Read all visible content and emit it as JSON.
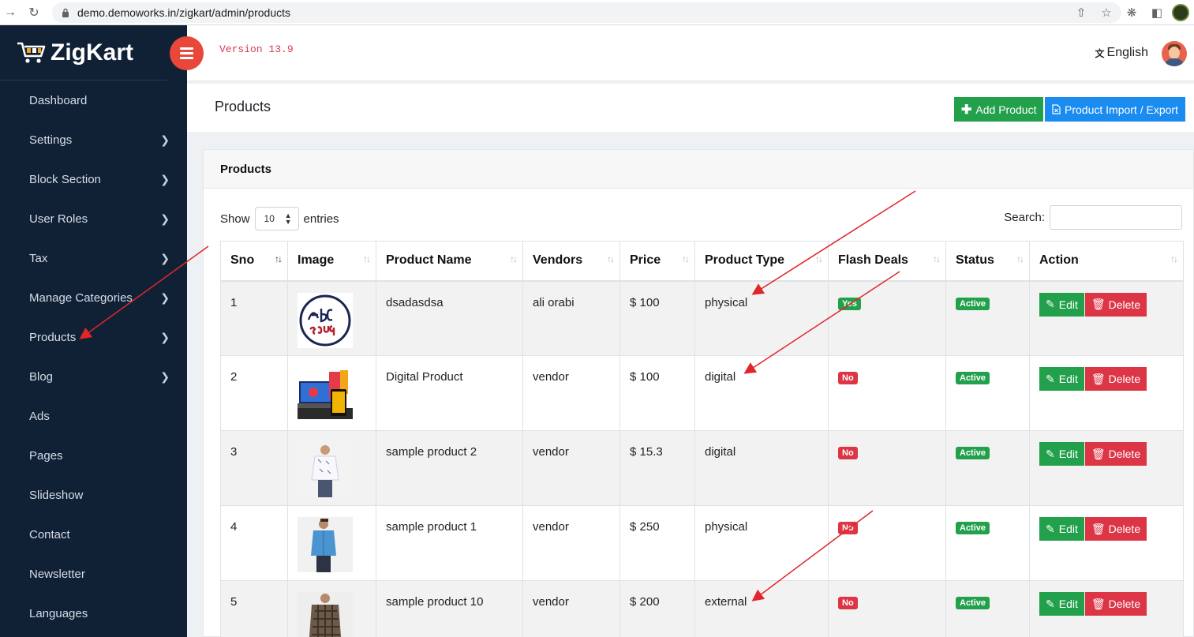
{
  "browser": {
    "url": "demo.demoworks.in/zigkart/admin/products"
  },
  "brand": {
    "name": "ZigKart"
  },
  "sidebar": {
    "items": [
      {
        "label": "Dashboard",
        "chevron": false
      },
      {
        "label": "Settings",
        "chevron": true
      },
      {
        "label": "Block Section",
        "chevron": true
      },
      {
        "label": "User Roles",
        "chevron": true
      },
      {
        "label": "Tax",
        "chevron": true
      },
      {
        "label": "Manage Categories",
        "chevron": true
      },
      {
        "label": "Products",
        "chevron": true
      },
      {
        "label": "Blog",
        "chevron": true
      },
      {
        "label": "Ads",
        "chevron": false
      },
      {
        "label": "Pages",
        "chevron": false
      },
      {
        "label": "Slideshow",
        "chevron": false
      },
      {
        "label": "Contact",
        "chevron": false
      },
      {
        "label": "Newsletter",
        "chevron": false
      },
      {
        "label": "Languages",
        "chevron": false
      }
    ]
  },
  "topbar": {
    "version": "Version 13.9",
    "language": "English"
  },
  "page": {
    "title": "Products",
    "add_button": "Add Product",
    "import_button": "Product Import / Export"
  },
  "card": {
    "title": "Products",
    "show_label": "Show",
    "entries_value": "10",
    "entries_label": "entries",
    "search_label": "Search:"
  },
  "table": {
    "headers": [
      "Sno",
      "Image",
      "Product Name",
      "Vendors",
      "Price",
      "Product Type",
      "Flash Deals",
      "Status",
      "Action"
    ],
    "rows": [
      {
        "sno": "1",
        "image": "abc-souq-logo",
        "name": "dsadasdsa",
        "vendor": "ali orabi",
        "price": "$ 100",
        "type": "physical",
        "flash": "Yes",
        "status": "Active"
      },
      {
        "sno": "2",
        "image": "digital-devices",
        "name": "Digital Product",
        "vendor": "vendor",
        "price": "$ 100",
        "type": "digital",
        "flash": "No",
        "status": "Active"
      },
      {
        "sno": "3",
        "image": "white-shirt-model",
        "name": "sample product 2",
        "vendor": "vendor",
        "price": "$ 15.3",
        "type": "digital",
        "flash": "No",
        "status": "Active"
      },
      {
        "sno": "4",
        "image": "blue-shirt-model",
        "name": "sample product 1",
        "vendor": "vendor",
        "price": "$ 250",
        "type": "physical",
        "flash": "No",
        "status": "Active"
      },
      {
        "sno": "5",
        "image": "plaid-shirt-model",
        "name": "sample product 10",
        "vendor": "vendor",
        "price": "$ 200",
        "type": "external",
        "flash": "No",
        "status": "Active"
      }
    ],
    "edit_label": "Edit",
    "delete_label": "Delete"
  },
  "colors": {
    "sidebar": "#102136",
    "accent_red": "#e8473a",
    "green": "#22a04b",
    "blue": "#1a8cf0",
    "danger": "#dc3545",
    "annotation_arrow": "#e0262a"
  }
}
